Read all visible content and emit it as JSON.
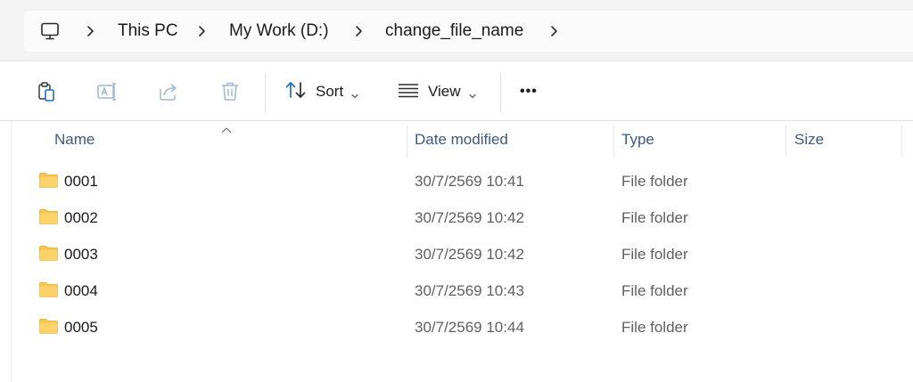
{
  "address_bar": {
    "icon": "this-pc-icon",
    "crumbs": [
      "This PC",
      "My Work (D:)",
      "change_file_name"
    ]
  },
  "toolbar": {
    "icons": [
      "clipboard-icon",
      "rename-icon",
      "share-icon",
      "delete-icon"
    ],
    "sort_label": "Sort",
    "view_label": "View",
    "more_label": "•••"
  },
  "columns": {
    "name": "Name",
    "date": "Date modified",
    "type": "Type",
    "size": "Size"
  },
  "files": [
    {
      "name": "0001",
      "date": "30/7/2569 10:41",
      "type": "File folder"
    },
    {
      "name": "0002",
      "date": "30/7/2569 10:42",
      "type": "File folder"
    },
    {
      "name": "0003",
      "date": "30/7/2569 10:42",
      "type": "File folder"
    },
    {
      "name": "0004",
      "date": "30/7/2569 10:43",
      "type": "File folder"
    },
    {
      "name": "0005",
      "date": "30/7/2569 10:44",
      "type": "File folder"
    }
  ],
  "colors": {
    "folder": "#f8c64a",
    "header_text": "#3d5a80",
    "disabled_icon": "#9fb7cf"
  }
}
